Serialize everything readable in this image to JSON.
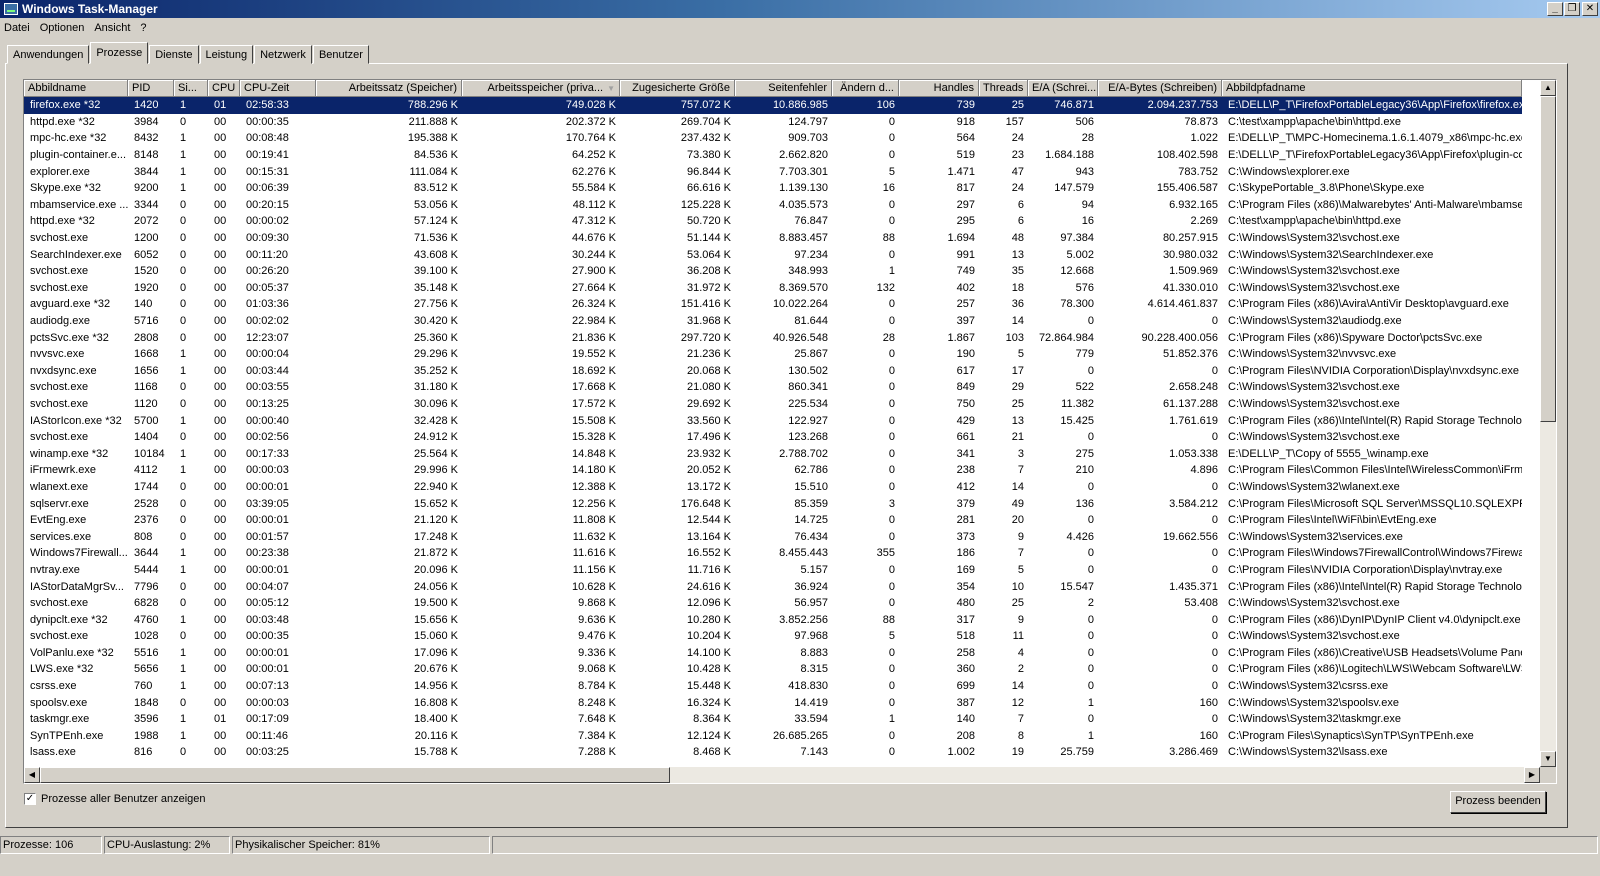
{
  "window": {
    "title": "Windows Task-Manager"
  },
  "menu": [
    "Datei",
    "Optionen",
    "Ansicht",
    "?"
  ],
  "tabs": [
    "Anwendungen",
    "Prozesse",
    "Dienste",
    "Leistung",
    "Netzwerk",
    "Benutzer"
  ],
  "active_tab": 1,
  "columns": [
    "Abbildname",
    "PID",
    "Si...",
    "CPU",
    "CPU-Zeit",
    "Arbeitssatz (Speicher)",
    "Arbeitsspeicher (priva...",
    "Zugesicherte Größe",
    "Seitenfehler",
    "Ändern d...",
    "Handles",
    "Threads",
    "E/A (Schrei...",
    "E/A-Bytes (Schreiben)",
    "Abbildpfadname"
  ],
  "sorted_column": 6,
  "selected_row": 0,
  "processes": [
    [
      "firefox.exe *32",
      "1420",
      "1",
      "01",
      "02:58:33",
      "788.296 K",
      "749.028 K",
      "757.072 K",
      "10.886.985",
      "106",
      "739",
      "25",
      "746.871",
      "2.094.237.753",
      "E:\\DELL\\P_T\\FirefoxPortableLegacy36\\App\\Firefox\\firefox.exe"
    ],
    [
      "httpd.exe *32",
      "3984",
      "0",
      "00",
      "00:00:35",
      "211.888 K",
      "202.372 K",
      "269.704 K",
      "124.797",
      "0",
      "918",
      "157",
      "506",
      "78.873",
      "C:\\test\\xampp\\apache\\bin\\httpd.exe"
    ],
    [
      "mpc-hc.exe *32",
      "8432",
      "1",
      "00",
      "00:08:48",
      "195.388 K",
      "170.764 K",
      "237.432 K",
      "909.703",
      "0",
      "564",
      "24",
      "28",
      "1.022",
      "E:\\DELL\\P_T\\MPC-Homecinema.1.6.1.4079_x86\\mpc-hc.exe"
    ],
    [
      "plugin-container.e...",
      "8148",
      "1",
      "00",
      "00:19:41",
      "84.536 K",
      "64.252 K",
      "73.380 K",
      "2.662.820",
      "0",
      "519",
      "23",
      "1.684.188",
      "108.402.598",
      "E:\\DELL\\P_T\\FirefoxPortableLegacy36\\App\\Firefox\\plugin-con"
    ],
    [
      "explorer.exe",
      "3844",
      "1",
      "00",
      "00:15:31",
      "111.084 K",
      "62.276 K",
      "96.844 K",
      "7.703.301",
      "5",
      "1.471",
      "47",
      "943",
      "783.752",
      "C:\\Windows\\explorer.exe"
    ],
    [
      "Skype.exe *32",
      "9200",
      "1",
      "00",
      "00:06:39",
      "83.512 K",
      "55.584 K",
      "66.616 K",
      "1.139.130",
      "16",
      "817",
      "24",
      "147.579",
      "155.406.587",
      "C:\\SkypePortable_3.8\\Phone\\Skype.exe"
    ],
    [
      "mbamservice.exe ...",
      "3344",
      "0",
      "00",
      "00:20:15",
      "53.056 K",
      "48.112 K",
      "125.228 K",
      "4.035.573",
      "0",
      "297",
      "6",
      "94",
      "6.932.165",
      "C:\\Program Files (x86)\\Malwarebytes' Anti-Malware\\mbamserv"
    ],
    [
      "httpd.exe *32",
      "2072",
      "0",
      "00",
      "00:00:02",
      "57.124 K",
      "47.312 K",
      "50.720 K",
      "76.847",
      "0",
      "295",
      "6",
      "16",
      "2.269",
      "C:\\test\\xampp\\apache\\bin\\httpd.exe"
    ],
    [
      "svchost.exe",
      "1200",
      "0",
      "00",
      "00:09:30",
      "71.536 K",
      "44.676 K",
      "51.144 K",
      "8.883.457",
      "88",
      "1.694",
      "48",
      "97.384",
      "80.257.915",
      "C:\\Windows\\System32\\svchost.exe"
    ],
    [
      "SearchIndexer.exe",
      "6052",
      "0",
      "00",
      "00:11:20",
      "43.608 K",
      "30.244 K",
      "53.064 K",
      "97.234",
      "0",
      "991",
      "13",
      "5.002",
      "30.980.032",
      "C:\\Windows\\System32\\SearchIndexer.exe"
    ],
    [
      "svchost.exe",
      "1520",
      "0",
      "00",
      "00:26:20",
      "39.100 K",
      "27.900 K",
      "36.208 K",
      "348.993",
      "1",
      "749",
      "35",
      "12.668",
      "1.509.969",
      "C:\\Windows\\System32\\svchost.exe"
    ],
    [
      "svchost.exe",
      "1920",
      "0",
      "00",
      "00:05:37",
      "35.148 K",
      "27.664 K",
      "31.972 K",
      "8.369.570",
      "132",
      "402",
      "18",
      "576",
      "41.330.010",
      "C:\\Windows\\System32\\svchost.exe"
    ],
    [
      "avguard.exe *32",
      "140",
      "0",
      "00",
      "01:03:36",
      "27.756 K",
      "26.324 K",
      "151.416 K",
      "10.022.264",
      "0",
      "257",
      "36",
      "78.300",
      "4.614.461.837",
      "C:\\Program Files (x86)\\Avira\\AntiVir Desktop\\avguard.exe"
    ],
    [
      "audiodg.exe",
      "5716",
      "0",
      "00",
      "00:02:02",
      "30.420 K",
      "22.984 K",
      "31.968 K",
      "81.644",
      "0",
      "397",
      "14",
      "0",
      "0",
      "C:\\Windows\\System32\\audiodg.exe"
    ],
    [
      "pctsSvc.exe *32",
      "2808",
      "0",
      "00",
      "12:23:07",
      "25.360 K",
      "21.836 K",
      "297.720 K",
      "40.926.548",
      "28",
      "1.867",
      "103",
      "72.864.984",
      "90.228.400.056",
      "C:\\Program Files (x86)\\Spyware Doctor\\pctsSvc.exe"
    ],
    [
      "nvvsvc.exe",
      "1668",
      "1",
      "00",
      "00:00:04",
      "29.296 K",
      "19.552 K",
      "21.236 K",
      "25.867",
      "0",
      "190",
      "5",
      "779",
      "51.852.376",
      "C:\\Windows\\System32\\nvvsvc.exe"
    ],
    [
      "nvxdsync.exe",
      "1656",
      "1",
      "00",
      "00:03:44",
      "35.252 K",
      "18.692 K",
      "20.068 K",
      "130.502",
      "0",
      "617",
      "17",
      "0",
      "0",
      "C:\\Program Files\\NVIDIA Corporation\\Display\\nvxdsync.exe"
    ],
    [
      "svchost.exe",
      "1168",
      "0",
      "00",
      "00:03:55",
      "31.180 K",
      "17.668 K",
      "21.080 K",
      "860.341",
      "0",
      "849",
      "29",
      "522",
      "2.658.248",
      "C:\\Windows\\System32\\svchost.exe"
    ],
    [
      "svchost.exe",
      "1120",
      "0",
      "00",
      "00:13:25",
      "30.096 K",
      "17.572 K",
      "29.692 K",
      "225.534",
      "0",
      "750",
      "25",
      "11.382",
      "61.137.288",
      "C:\\Windows\\System32\\svchost.exe"
    ],
    [
      "IAStorIcon.exe *32",
      "5700",
      "1",
      "00",
      "00:00:40",
      "32.428 K",
      "15.508 K",
      "33.560 K",
      "122.927",
      "0",
      "429",
      "13",
      "15.425",
      "1.761.619",
      "C:\\Program Files (x86)\\Intel\\Intel(R) Rapid Storage Technolog"
    ],
    [
      "svchost.exe",
      "1404",
      "0",
      "00",
      "00:02:56",
      "24.912 K",
      "15.328 K",
      "17.496 K",
      "123.268",
      "0",
      "661",
      "21",
      "0",
      "0",
      "C:\\Windows\\System32\\svchost.exe"
    ],
    [
      "winamp.exe *32",
      "10184",
      "1",
      "00",
      "00:17:33",
      "25.564 K",
      "14.848 K",
      "23.932 K",
      "2.788.702",
      "0",
      "341",
      "3",
      "275",
      "1.053.338",
      "E:\\DELL\\P_T\\Copy of 5555_\\winamp.exe"
    ],
    [
      "iFrmewrk.exe",
      "4112",
      "1",
      "00",
      "00:00:03",
      "29.996 K",
      "14.180 K",
      "20.052 K",
      "62.786",
      "0",
      "238",
      "7",
      "210",
      "4.896",
      "C:\\Program Files\\Common Files\\Intel\\WirelessCommon\\iFrmew"
    ],
    [
      "wlanext.exe",
      "1744",
      "0",
      "00",
      "00:00:01",
      "22.940 K",
      "12.388 K",
      "13.172 K",
      "15.510",
      "0",
      "412",
      "14",
      "0",
      "0",
      "C:\\Windows\\System32\\wlanext.exe"
    ],
    [
      "sqlservr.exe",
      "2528",
      "0",
      "00",
      "03:39:05",
      "15.652 K",
      "12.256 K",
      "176.648 K",
      "85.359",
      "3",
      "379",
      "49",
      "136",
      "3.584.212",
      "C:\\Program Files\\Microsoft SQL Server\\MSSQL10.SQLEXPRESS"
    ],
    [
      "EvtEng.exe",
      "2376",
      "0",
      "00",
      "00:00:01",
      "21.120 K",
      "11.808 K",
      "12.544 K",
      "14.725",
      "0",
      "281",
      "20",
      "0",
      "0",
      "C:\\Program Files\\Intel\\WiFi\\bin\\EvtEng.exe"
    ],
    [
      "services.exe",
      "808",
      "0",
      "00",
      "00:01:57",
      "17.248 K",
      "11.632 K",
      "13.164 K",
      "76.434",
      "0",
      "373",
      "9",
      "4.426",
      "19.662.556",
      "C:\\Windows\\System32\\services.exe"
    ],
    [
      "Windows7Firewall...",
      "3644",
      "1",
      "00",
      "00:23:38",
      "21.872 K",
      "11.616 K",
      "16.552 K",
      "8.455.443",
      "355",
      "186",
      "7",
      "0",
      "0",
      "C:\\Program Files\\Windows7FirewallControl\\Windows7FirewallC"
    ],
    [
      "nvtray.exe",
      "5444",
      "1",
      "00",
      "00:00:01",
      "20.096 K",
      "11.156 K",
      "11.716 K",
      "5.157",
      "0",
      "169",
      "5",
      "0",
      "0",
      "C:\\Program Files\\NVIDIA Corporation\\Display\\nvtray.exe"
    ],
    [
      "IAStorDataMgrSv...",
      "7796",
      "0",
      "00",
      "00:04:07",
      "24.056 K",
      "10.628 K",
      "24.616 K",
      "36.924",
      "0",
      "354",
      "10",
      "15.547",
      "1.435.371",
      "C:\\Program Files (x86)\\Intel\\Intel(R) Rapid Storage Technolog"
    ],
    [
      "svchost.exe",
      "6828",
      "0",
      "00",
      "00:05:12",
      "19.500 K",
      "9.868 K",
      "12.096 K",
      "56.957",
      "0",
      "480",
      "25",
      "2",
      "53.408",
      "C:\\Windows\\System32\\svchost.exe"
    ],
    [
      "dynipclt.exe *32",
      "4760",
      "1",
      "00",
      "00:03:48",
      "15.656 K",
      "9.636 K",
      "10.280 K",
      "3.852.256",
      "88",
      "317",
      "9",
      "0",
      "0",
      "C:\\Program Files (x86)\\DynIP\\DynIP Client v4.0\\dynipclt.exe"
    ],
    [
      "svchost.exe",
      "1028",
      "0",
      "00",
      "00:00:35",
      "15.060 K",
      "9.476 K",
      "10.204 K",
      "97.968",
      "5",
      "518",
      "11",
      "0",
      "0",
      "C:\\Windows\\System32\\svchost.exe"
    ],
    [
      "VolPanlu.exe *32",
      "5516",
      "1",
      "00",
      "00:00:01",
      "17.096 K",
      "9.336 K",
      "14.100 K",
      "8.883",
      "0",
      "258",
      "4",
      "0",
      "0",
      "C:\\Program Files (x86)\\Creative\\USB Headsets\\Volume Panel\\"
    ],
    [
      "LWS.exe *32",
      "5656",
      "1",
      "00",
      "00:00:01",
      "20.676 K",
      "9.068 K",
      "10.428 K",
      "8.315",
      "0",
      "360",
      "2",
      "0",
      "0",
      "C:\\Program Files (x86)\\Logitech\\LWS\\Webcam Software\\LWS"
    ],
    [
      "csrss.exe",
      "760",
      "1",
      "00",
      "00:07:13",
      "14.956 K",
      "8.784 K",
      "15.448 K",
      "418.830",
      "0",
      "699",
      "14",
      "0",
      "0",
      "C:\\Windows\\System32\\csrss.exe"
    ],
    [
      "spoolsv.exe",
      "1848",
      "0",
      "00",
      "00:00:03",
      "16.808 K",
      "8.248 K",
      "16.324 K",
      "14.419",
      "0",
      "387",
      "12",
      "1",
      "160",
      "C:\\Windows\\System32\\spoolsv.exe"
    ],
    [
      "taskmgr.exe",
      "3596",
      "1",
      "01",
      "00:17:09",
      "18.400 K",
      "7.648 K",
      "8.364 K",
      "33.594",
      "1",
      "140",
      "7",
      "0",
      "0",
      "C:\\Windows\\System32\\taskmgr.exe"
    ],
    [
      "SynTPEnh.exe",
      "1988",
      "1",
      "00",
      "00:11:46",
      "20.116 K",
      "7.384 K",
      "12.124 K",
      "26.685.265",
      "0",
      "208",
      "8",
      "1",
      "160",
      "C:\\Program Files\\Synaptics\\SynTP\\SynTPEnh.exe"
    ],
    [
      "lsass.exe",
      "816",
      "0",
      "00",
      "00:03:25",
      "15.788 K",
      "7.288 K",
      "8.468 K",
      "7.143",
      "0",
      "1.002",
      "19",
      "25.759",
      "3.286.469",
      "C:\\Windows\\System32\\lsass.exe"
    ]
  ],
  "show_all_users": {
    "label": "Prozesse aller Benutzer anzeigen",
    "checked": true,
    "mark": "✓"
  },
  "end_process_button": "Prozess beenden",
  "statusbar": {
    "processes": "Prozesse: 106",
    "cpu": "CPU-Auslastung: 2%",
    "memory": "Physikalischer Speicher: 81%"
  }
}
